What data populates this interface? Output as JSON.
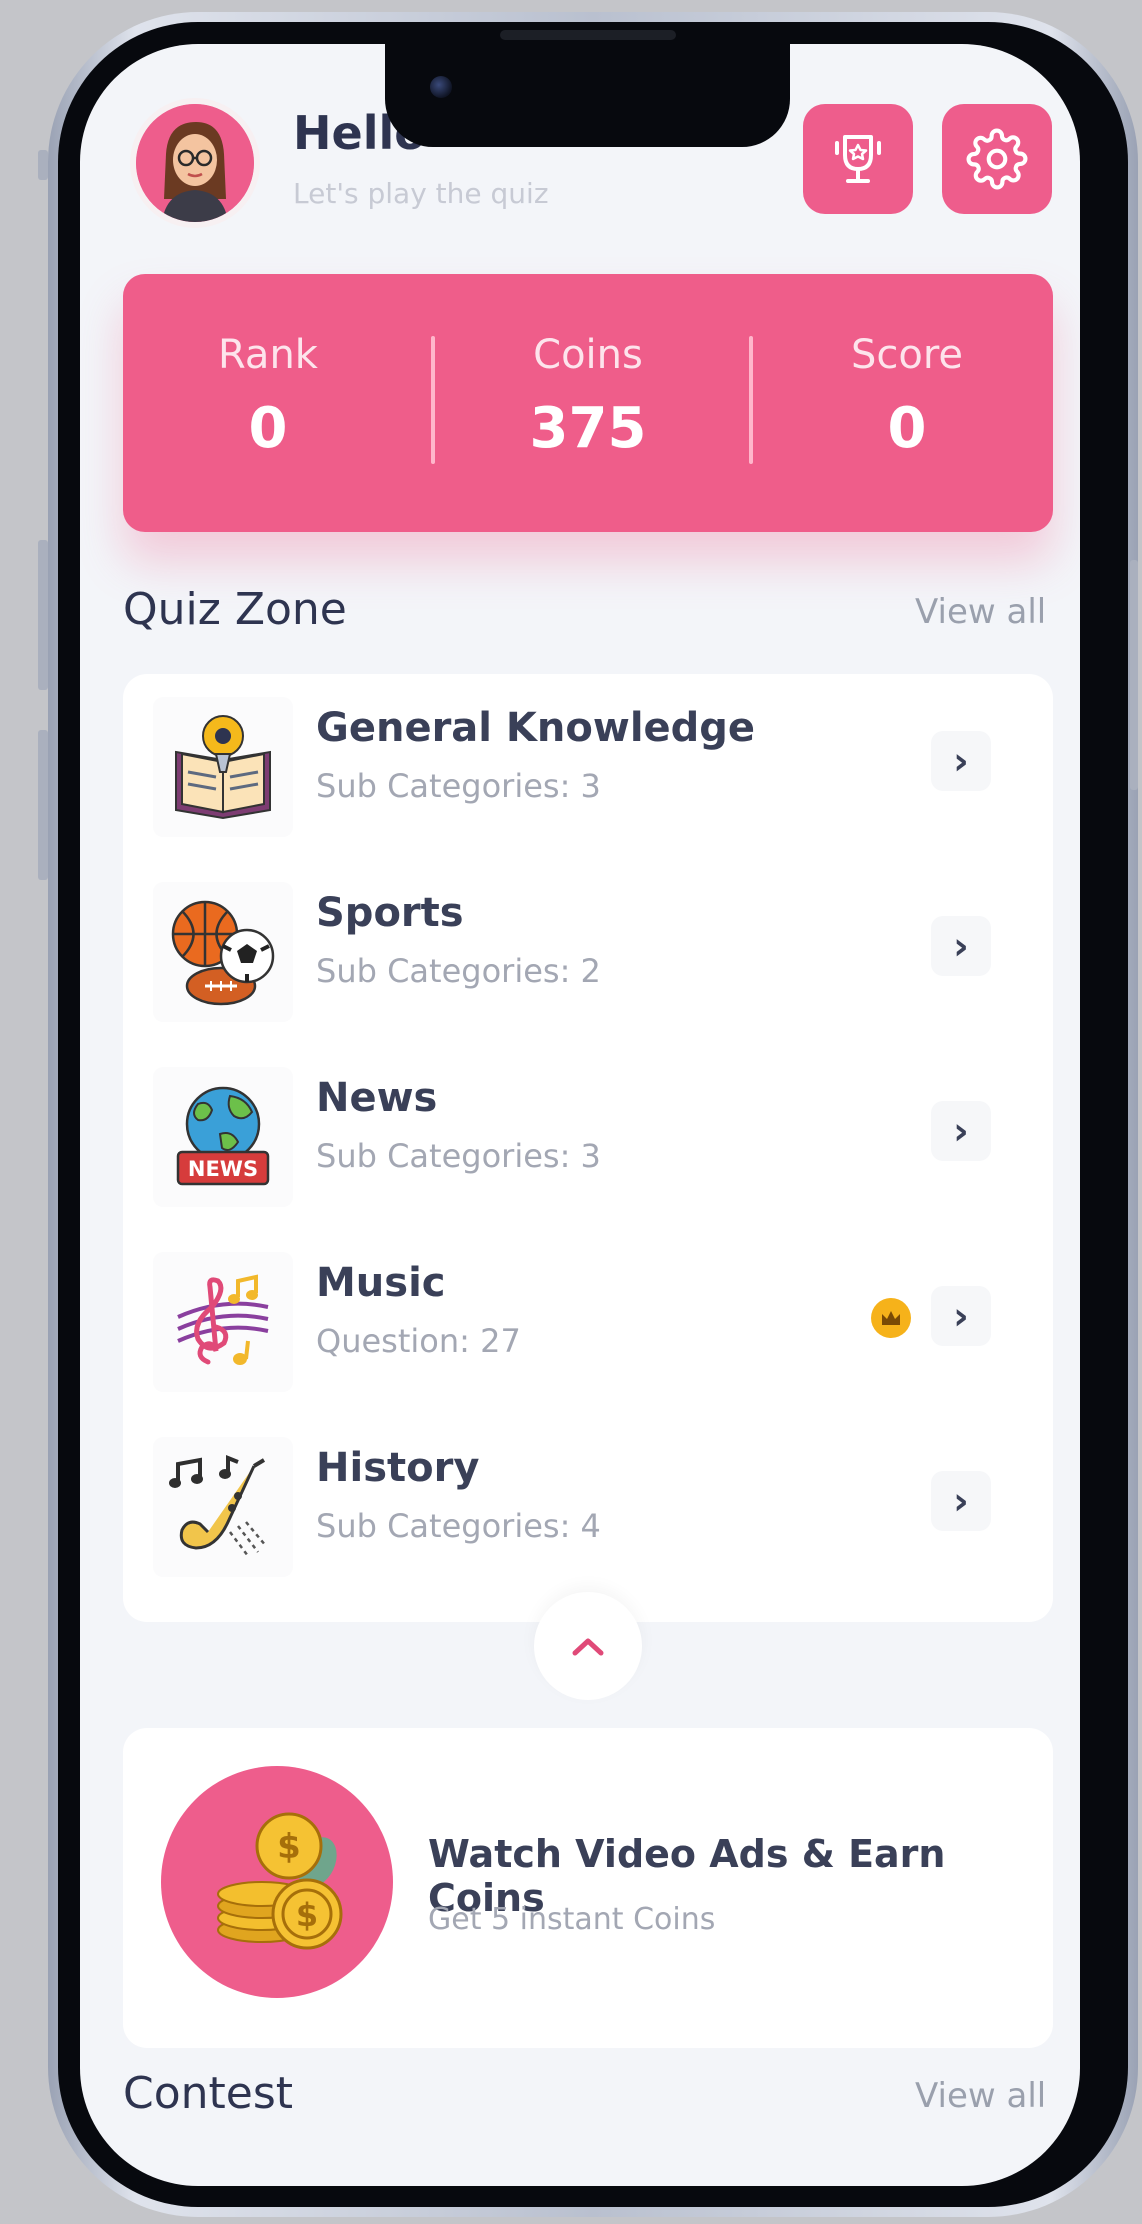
{
  "header": {
    "greeting": "Hello",
    "greeting_partial": "L",
    "subtitle": "Let's play the quiz",
    "avatar_icon": "user-avatar-icon",
    "leaderboard_icon": "trophy-icon",
    "settings_icon": "gear-icon"
  },
  "stats": {
    "rank_label": "Rank",
    "rank_value": "0",
    "coins_label": "Coins",
    "coins_value": "375",
    "score_label": "Score",
    "score_value": "0"
  },
  "quiz_zone": {
    "title": "Quiz Zone",
    "view_all": "View all",
    "items": [
      {
        "title": "General Knowledge",
        "subtitle": "Sub Categories: 3",
        "icon": "book-idea-icon",
        "premium": false
      },
      {
        "title": "Sports",
        "subtitle": "Sub Categories: 2",
        "icon": "sports-balls-icon",
        "premium": false
      },
      {
        "title": "News",
        "subtitle": "Sub Categories: 3",
        "icon": "news-globe-icon",
        "icon_text": "NEWS",
        "premium": false
      },
      {
        "title": "Music",
        "subtitle": "Question: 27",
        "icon": "music-notes-icon",
        "premium": true
      },
      {
        "title": "History",
        "subtitle": "Sub Categories: 4",
        "icon": "saxophone-icon",
        "premium": false
      }
    ]
  },
  "ad": {
    "title": "Watch Video Ads & Earn Coins",
    "subtitle": "Get 5 instant Coins",
    "icon": "coins-stack-icon"
  },
  "contest": {
    "title": "Contest",
    "view_all": "View all"
  },
  "colors": {
    "accent": "#EE5D8C",
    "background": "#F3F5F9",
    "text_dark": "#2E3450",
    "text_muted": "#A3A7B3",
    "premium": "#F6B21A"
  }
}
